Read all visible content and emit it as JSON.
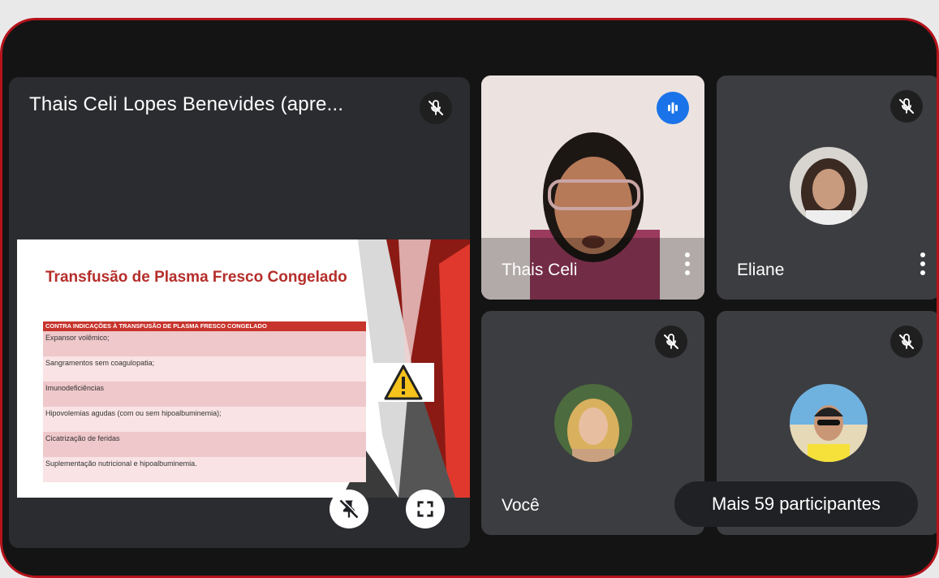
{
  "presenter": {
    "title": "Thais Celi Lopes Benevides (apre...",
    "mic_icon": "mic-off-icon",
    "controls": [
      {
        "name": "unpin-button",
        "icon": "pin-off-icon"
      },
      {
        "name": "fullscreen-button",
        "icon": "fullscreen-icon"
      }
    ]
  },
  "slide": {
    "title": "Transfusão de Plasma Fresco Congelado",
    "table_header": "CONTRA INDICAÇÕES À TRANSFUSÃO DE PLASMA FRESCO CONGELADO",
    "rows": [
      "Expansor volêmico;",
      "Sangramentos sem coagulopatia;",
      "Imunodeficiências",
      "Hipovolemias agudas (com ou sem hipoalbuminemia);",
      "Cicatrização de feridas",
      "Suplementação nutricional e hipoalbuminemia."
    ],
    "warning_icon": "warning-triangle-icon"
  },
  "participants": {
    "thais": {
      "name": "Thais Celi",
      "status_icon": "speaking-indicator-icon"
    },
    "eliane": {
      "name": "Eliane",
      "status_icon": "mic-off-icon"
    },
    "voce": {
      "name": "Você",
      "status_icon": "mic-off-icon"
    },
    "unnamed": {
      "status_icon": "mic-off-icon"
    }
  },
  "more_participants": "Mais 59 participantes",
  "colors": {
    "frame_border": "#b5121b",
    "tile_bg": "#3c3d40",
    "speaking_blue": "#1a73e8",
    "slide_red": "#c7342c"
  }
}
